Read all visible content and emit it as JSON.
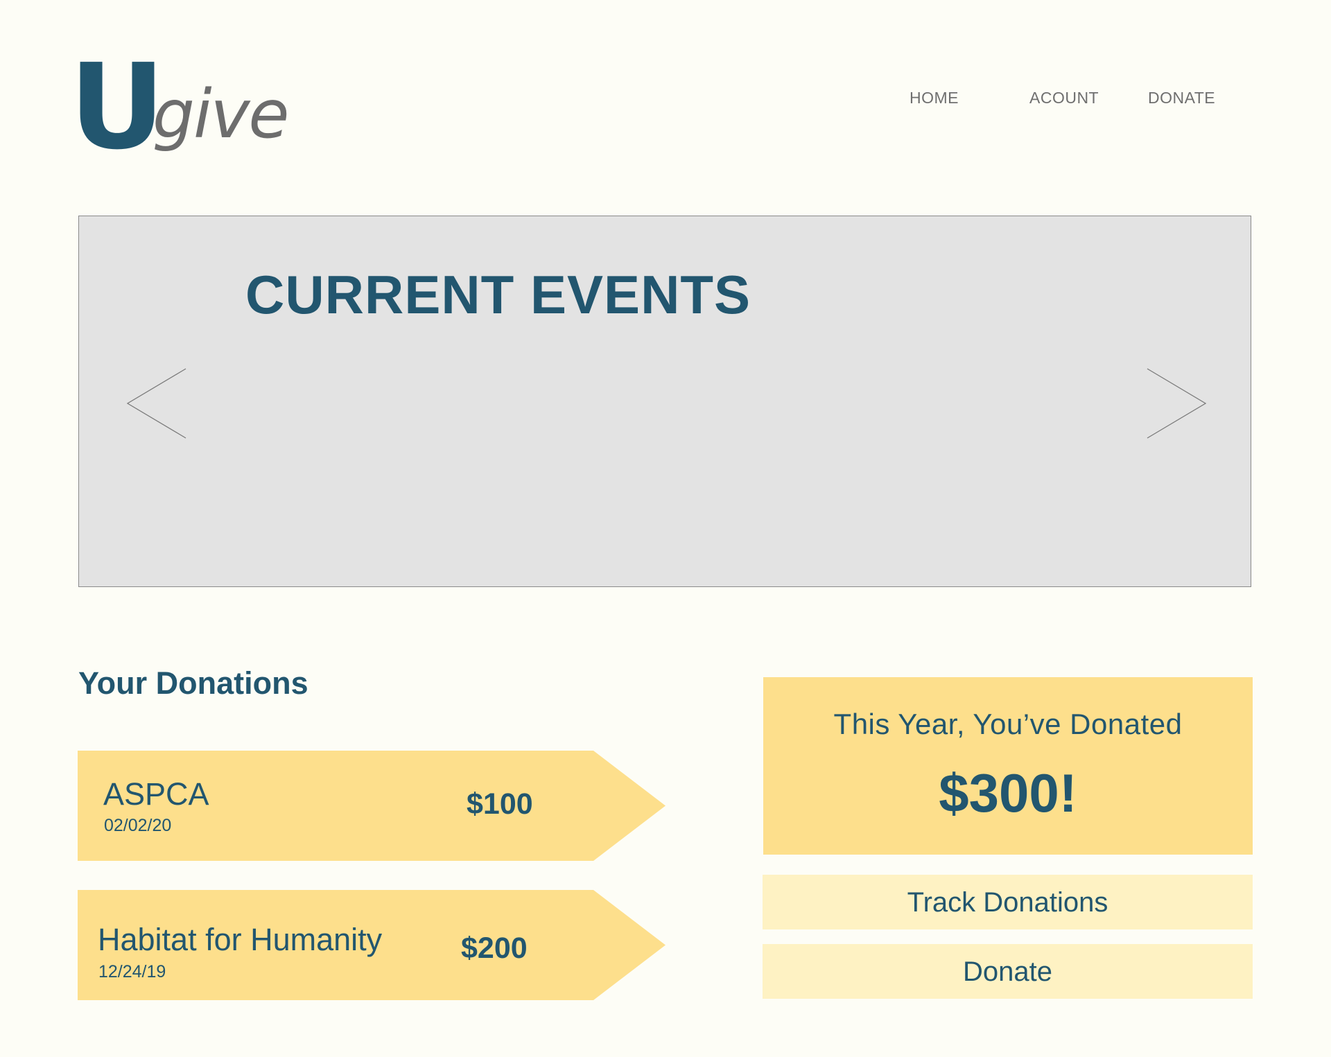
{
  "brand": {
    "logo_u": "U",
    "logo_give": "give",
    "primary_color": "#22566f",
    "accent_color": "#fddf8c",
    "light_accent_color": "#fef2c3"
  },
  "nav": {
    "home": "HOME",
    "account": "ACOUNT",
    "donate": "DONATE"
  },
  "hero": {
    "title": "CURRENT EVENTS",
    "prev_icon": "chevron-left-icon",
    "next_icon": "chevron-right-icon"
  },
  "donations": {
    "title": "Your Donations",
    "items": [
      {
        "org": "ASPCA",
        "date": "02/02/20",
        "amount": "$100"
      },
      {
        "org": "Habitat for Humanity",
        "date": "12/24/19",
        "amount": "$200"
      }
    ]
  },
  "summary": {
    "label": "This Year, You’ve Donated",
    "total": "$300!"
  },
  "actions": {
    "track": "Track Donations",
    "donate": "Donate"
  }
}
